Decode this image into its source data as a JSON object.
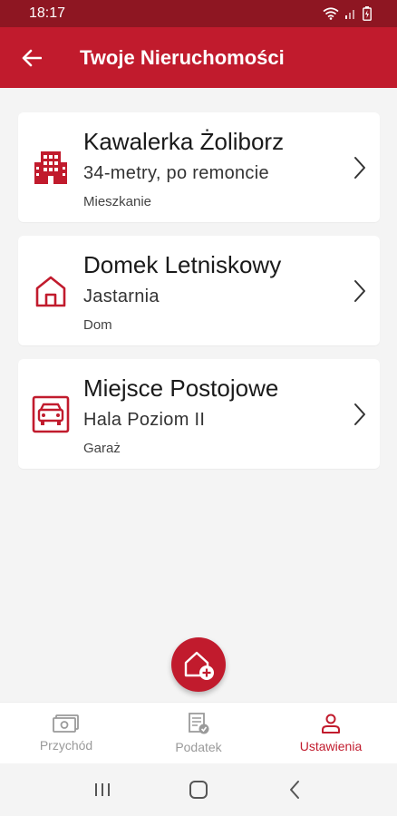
{
  "status_bar": {
    "time": "18:17"
  },
  "app_bar": {
    "title": "Twoje Nieruchomości"
  },
  "properties": [
    {
      "title": "Kawalerka Żoliborz",
      "subtitle": "34-metry, po remoncie",
      "type": "Mieszkanie",
      "icon": "apartment-building-icon"
    },
    {
      "title": "Domek Letniskowy",
      "subtitle": "Jastarnia",
      "type": "Dom",
      "icon": "house-icon"
    },
    {
      "title": "Miejsce Postojowe",
      "subtitle": "Hala Poziom II",
      "type": "Garaż",
      "icon": "garage-icon"
    }
  ],
  "fab": {
    "icon": "add-property-icon"
  },
  "bottom_nav": [
    {
      "label": "Przychód",
      "icon": "income-icon",
      "active": false
    },
    {
      "label": "Podatek",
      "icon": "tax-document-icon",
      "active": false
    },
    {
      "label": "Ustawienia",
      "icon": "person-icon",
      "active": true
    }
  ],
  "colors": {
    "primary": "#c11b2d",
    "status_bar": "#8e1622",
    "background": "#f4f4f4",
    "inactive": "#9a9a9a"
  }
}
